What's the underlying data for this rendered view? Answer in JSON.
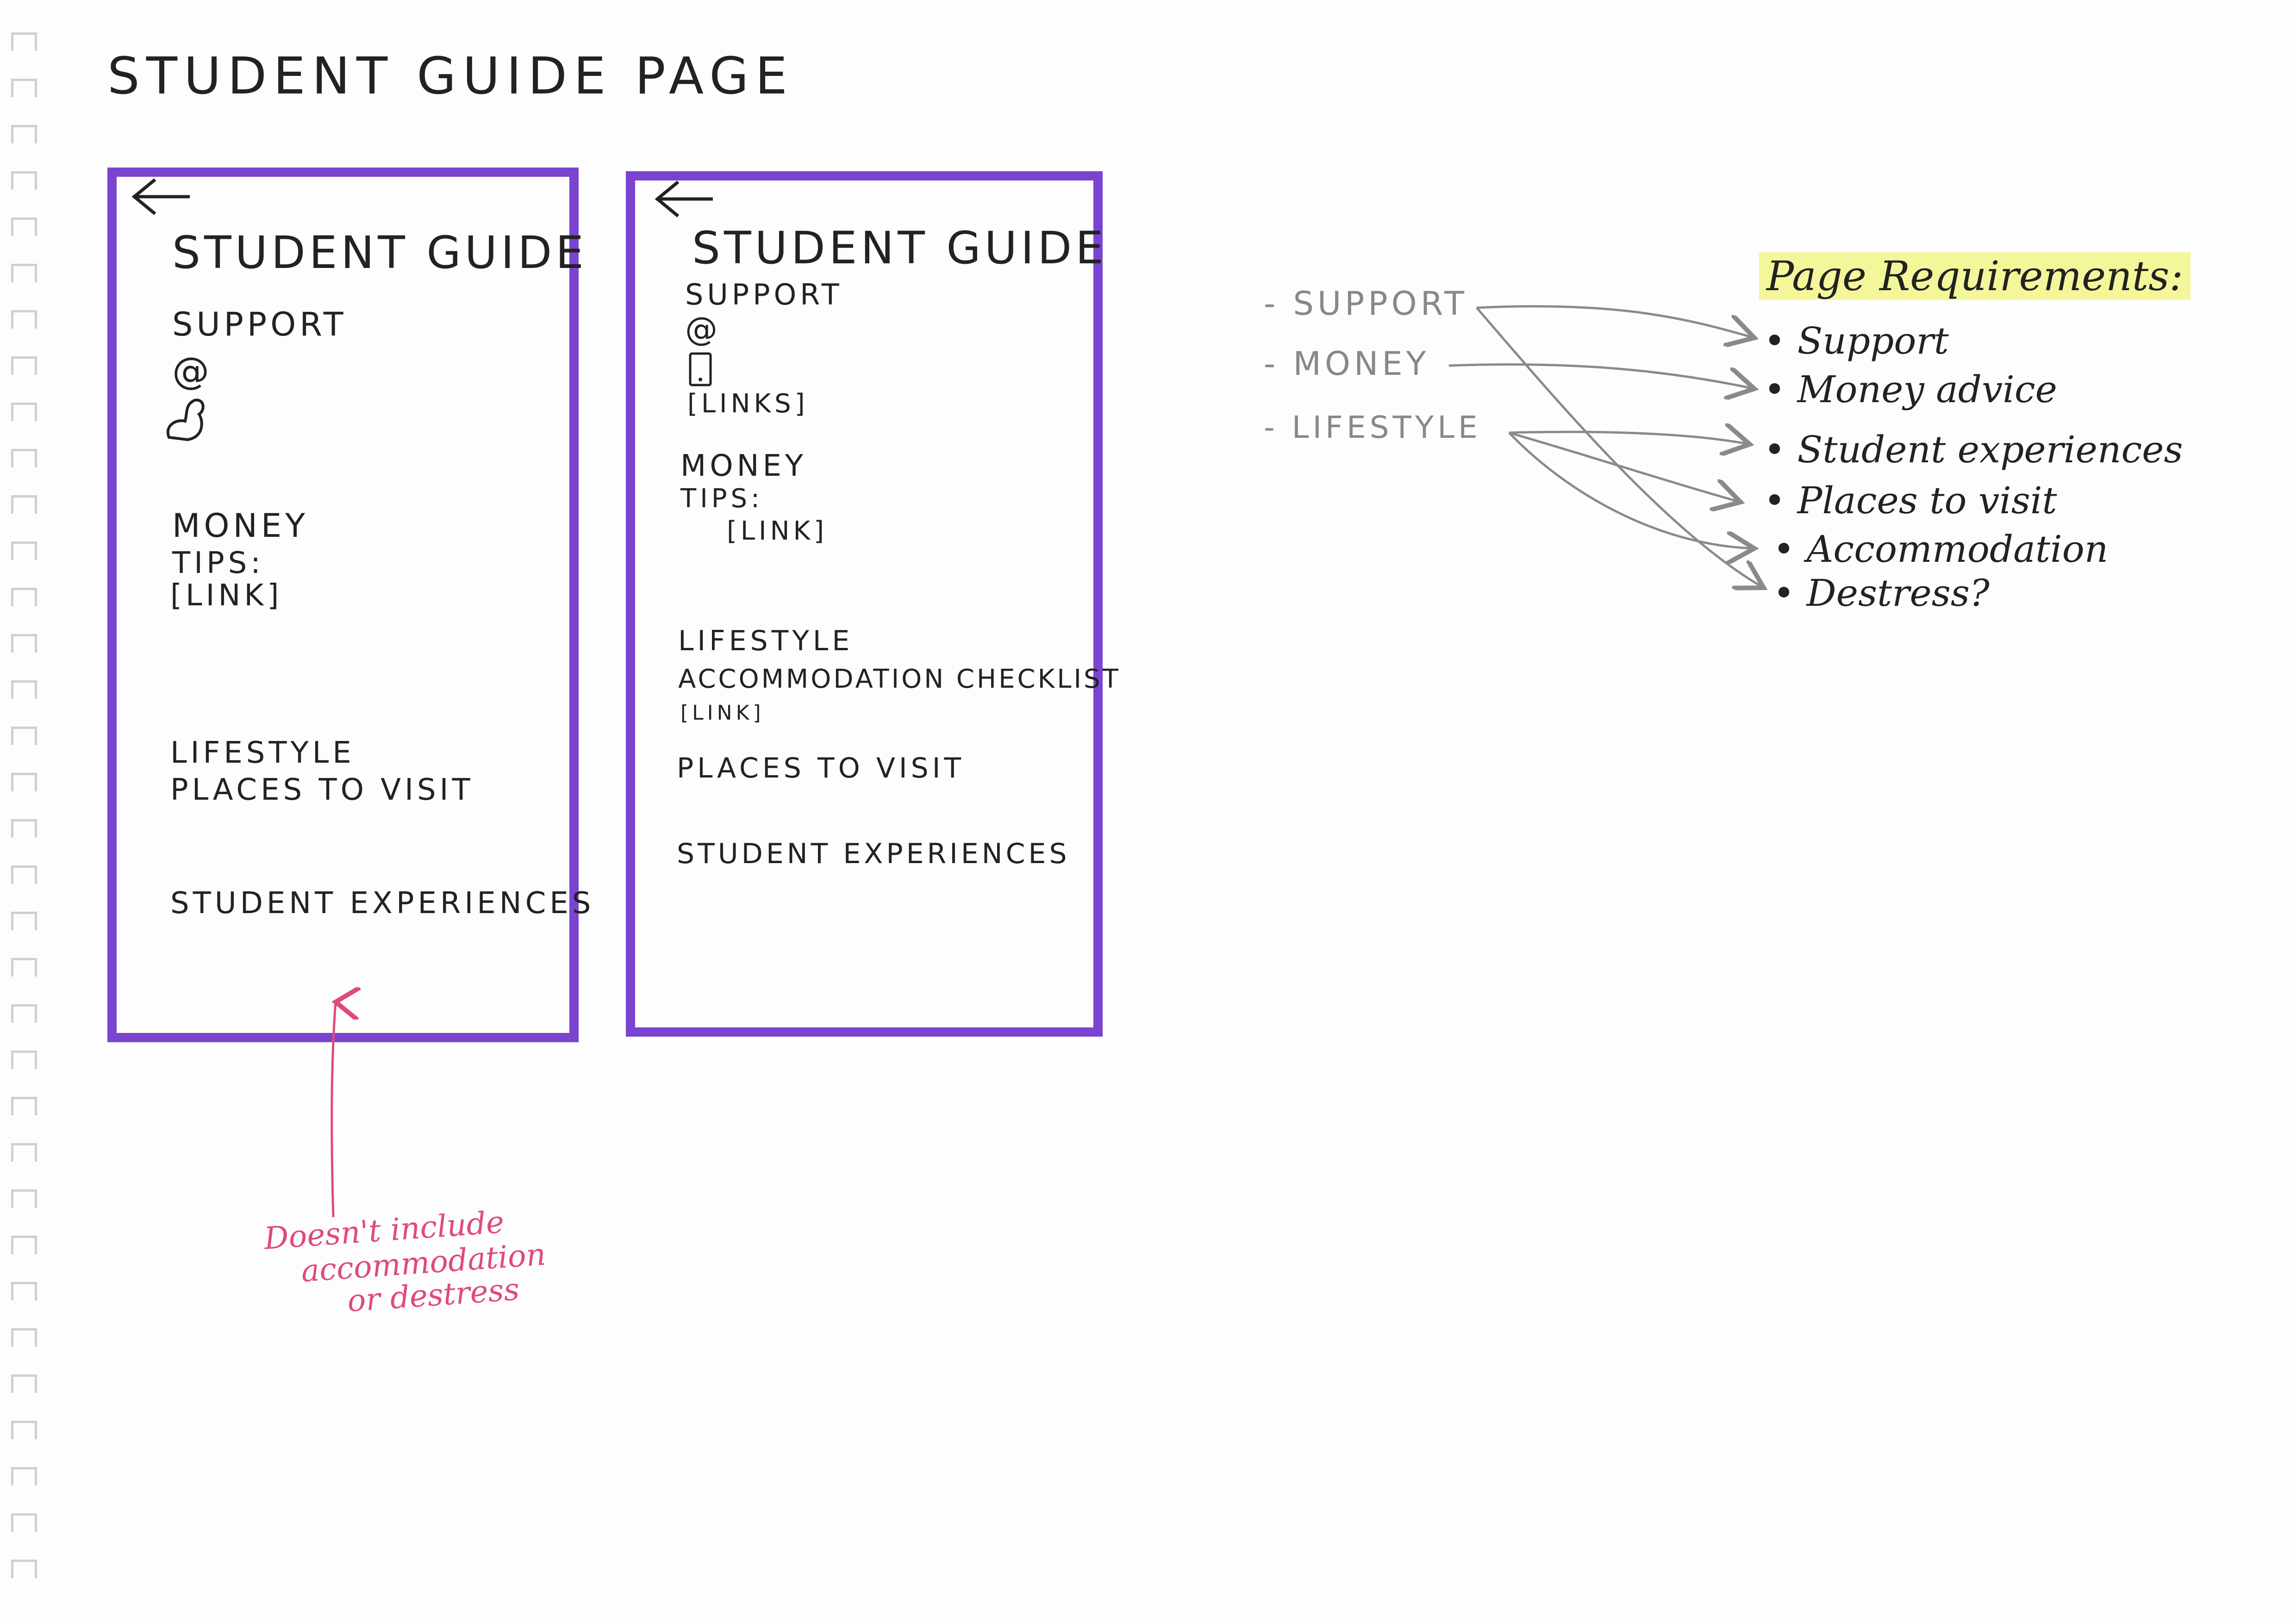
{
  "page": {
    "title": "STUDENT GUIDE PAGE"
  },
  "frame1": {
    "back_icon": "left-arrow-icon",
    "title": "STUDENT GUIDE",
    "support": "SUPPORT",
    "at": "@",
    "money": "MONEY",
    "tips": "TIPS:",
    "link": "[LINK]",
    "lifestyle": "LIFESTYLE",
    "places": "PLACES TO VISIT",
    "experiences": "STUDENT EXPERIENCES"
  },
  "frame2": {
    "back_icon": "left-arrow-icon",
    "title": "STUDENT GUIDE",
    "support": "SUPPORT",
    "at": "@",
    "links": "[LINKS]",
    "money": "MONEY",
    "tips": "TIPS:",
    "link": "[LINK]",
    "lifestyle": "LIFESTYLE",
    "accommodation": "ACCOMMODATION CHECKLIST",
    "acc_link": "[LINK]",
    "places": "PLACES TO VISIT",
    "experiences": "STUDENT EXPERIENCES"
  },
  "annotation": {
    "lines": [
      "Doesn't include",
      "accommodation",
      "or destress"
    ],
    "color": "#e04a7a"
  },
  "categories": [
    "- SUPPORT",
    "- MONEY",
    "- LIFESTYLE"
  ],
  "requirements": {
    "heading": "Page Requirements:",
    "items": [
      "• Support",
      "• Money advice",
      "• Student experiences",
      "• Places to visit",
      "• Accommodation",
      "• Destress?"
    ]
  },
  "colors": {
    "frame": "#7a44d0",
    "highlight": "#f3f79a",
    "annotation": "#e04a7a",
    "connector": "#8a8a8a"
  }
}
